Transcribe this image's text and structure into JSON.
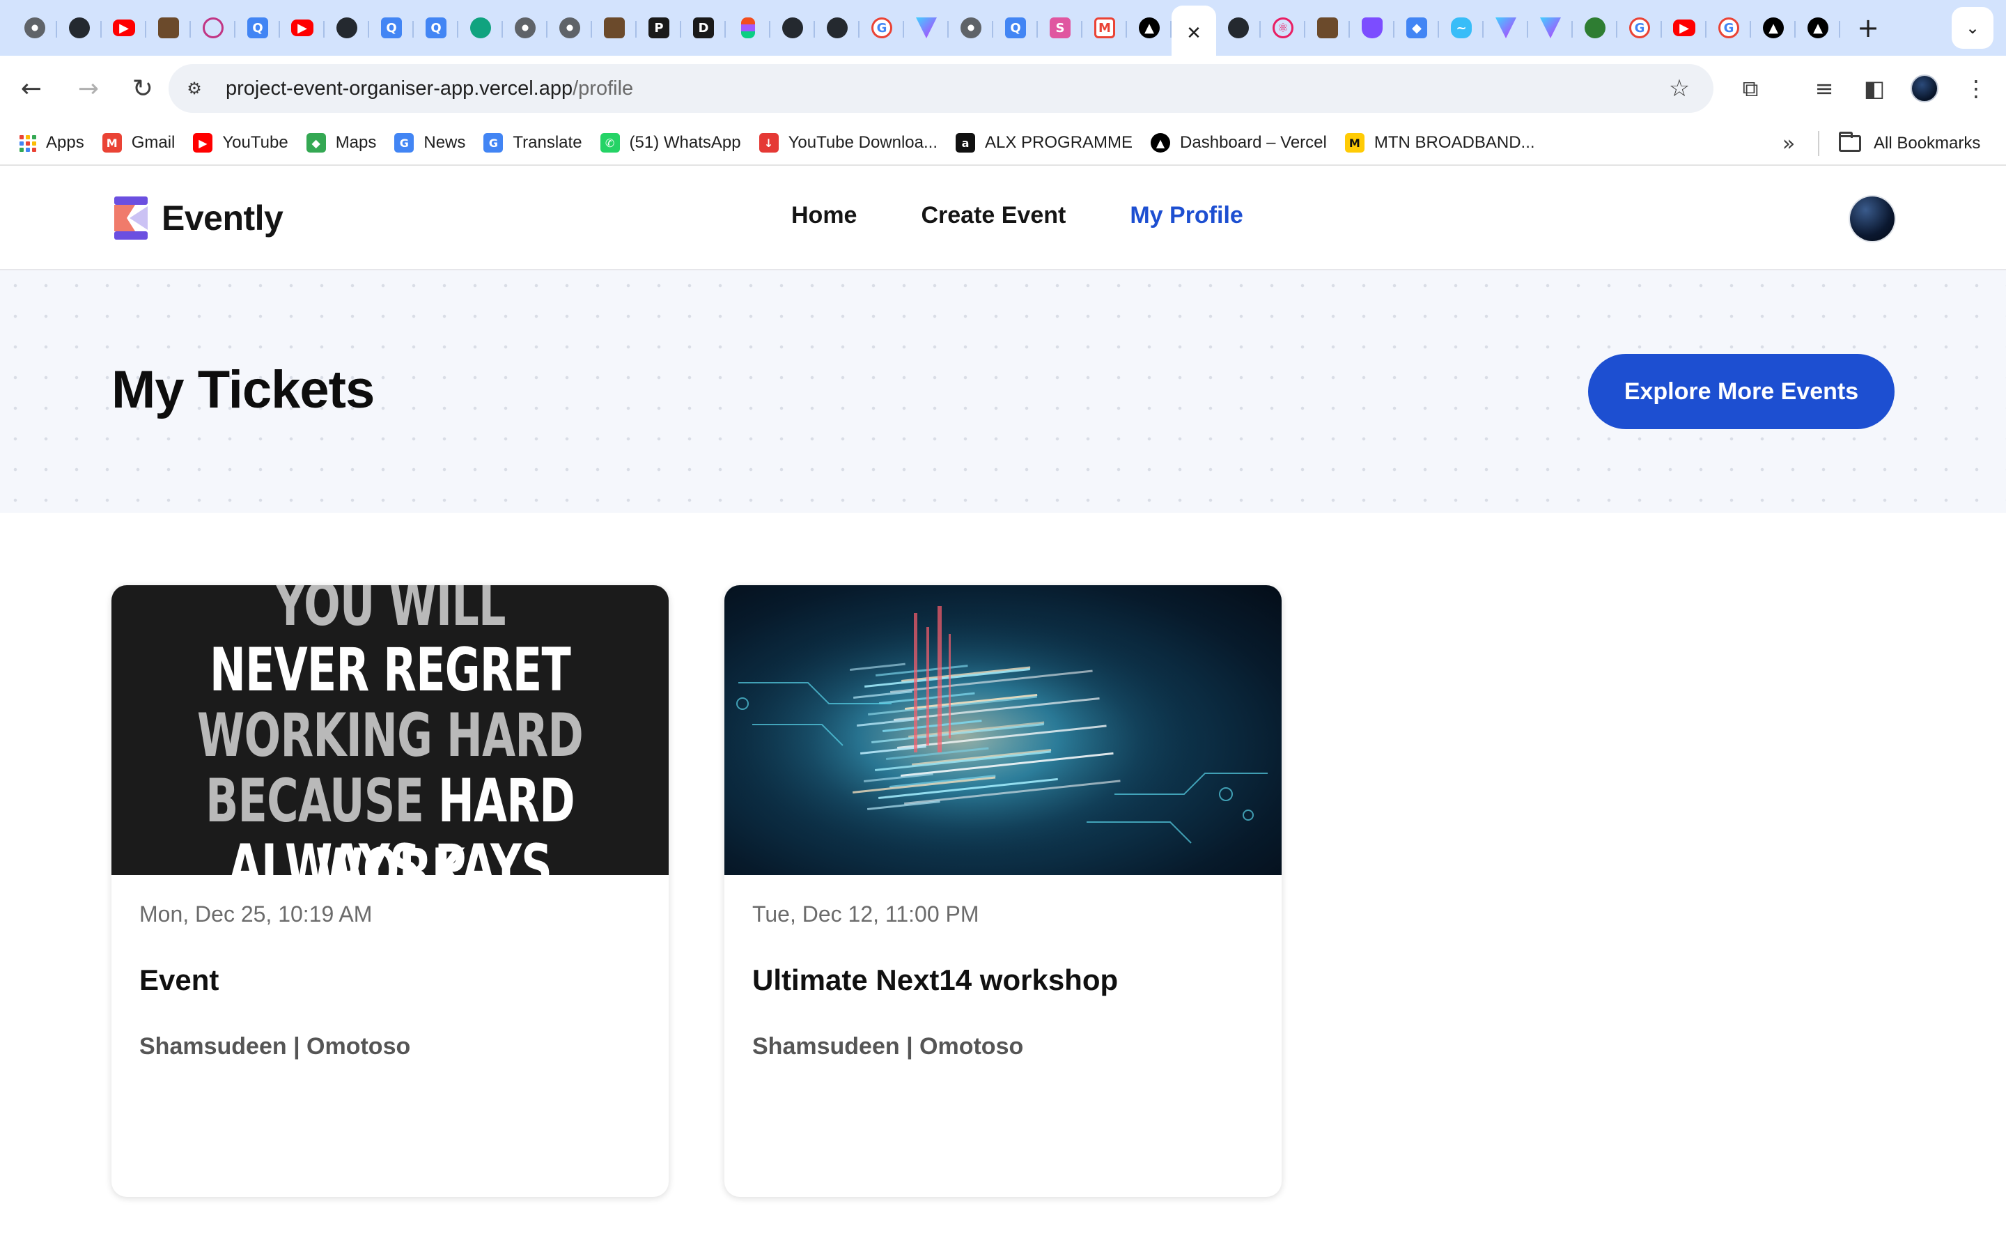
{
  "browser": {
    "tabs": [
      {
        "icon": "globe-icon"
      },
      {
        "icon": "github-icon"
      },
      {
        "icon": "youtube-icon"
      },
      {
        "icon": "book-icon"
      },
      {
        "icon": "instagram-icon"
      },
      {
        "icon": "q-icon"
      },
      {
        "icon": "youtube-icon"
      },
      {
        "icon": "github-icon"
      },
      {
        "icon": "q-icon"
      },
      {
        "icon": "q-icon"
      },
      {
        "icon": "chatgpt-icon"
      },
      {
        "icon": "globe-icon"
      },
      {
        "icon": "globe-icon"
      },
      {
        "icon": "book-icon"
      },
      {
        "icon": "p-icon"
      },
      {
        "icon": "d-icon"
      },
      {
        "icon": "figma-icon"
      },
      {
        "icon": "github-icon"
      },
      {
        "icon": "github-icon"
      },
      {
        "icon": "google-icon"
      },
      {
        "icon": "vite-icon"
      },
      {
        "icon": "globe-icon"
      },
      {
        "icon": "q-icon"
      },
      {
        "icon": "pink-app-icon"
      },
      {
        "icon": "gmail-icon"
      },
      {
        "icon": "vercel-icon"
      },
      {
        "icon": "close-icon",
        "active": true
      },
      {
        "icon": "github-icon"
      },
      {
        "icon": "react-icon"
      },
      {
        "icon": "bottle-icon"
      },
      {
        "icon": "shield-icon"
      },
      {
        "icon": "jira-icon"
      },
      {
        "icon": "tailwind-icon"
      },
      {
        "icon": "vite-icon"
      },
      {
        "icon": "vite-icon"
      },
      {
        "icon": "mongodb-icon"
      },
      {
        "icon": "google-icon"
      },
      {
        "icon": "youtube-icon"
      },
      {
        "icon": "google-icon"
      },
      {
        "icon": "vercel-icon"
      },
      {
        "icon": "vercel-icon"
      }
    ],
    "new_tab_label": "+",
    "url_host": "project-event-organiser-app.vercel.app",
    "url_path": "/profile",
    "bookmarks": [
      {
        "label": "Apps",
        "icon": "apps-grid-icon"
      },
      {
        "label": "Gmail",
        "icon": "gmail-icon",
        "color": "#ea4335"
      },
      {
        "label": "YouTube",
        "icon": "youtube-icon",
        "color": "#ff0000"
      },
      {
        "label": "Maps",
        "icon": "maps-icon",
        "color": "#34a853"
      },
      {
        "label": "News",
        "icon": "google-news-icon",
        "color": "#4285f4"
      },
      {
        "label": "Translate",
        "icon": "translate-icon",
        "color": "#4285f4"
      },
      {
        "label": "(51) WhatsApp",
        "icon": "whatsapp-icon",
        "color": "#25d366"
      },
      {
        "label": "YouTube Downloa...",
        "icon": "download-icon",
        "color": "#e53935"
      },
      {
        "label": "ALX PROGRAMME",
        "icon": "alx-icon",
        "color": "#111111"
      },
      {
        "label": "Dashboard – Vercel",
        "icon": "vercel-icon",
        "color": "#000000"
      },
      {
        "label": "MTN BROADBAND...",
        "icon": "mtn-icon",
        "color": "#ffcb05"
      }
    ],
    "all_bookmarks_label": "All Bookmarks"
  },
  "app": {
    "brand": "Evently",
    "nav": [
      {
        "label": "Home",
        "active": false
      },
      {
        "label": "Create Event",
        "active": false
      },
      {
        "label": "My Profile",
        "active": true
      }
    ],
    "accent_color": "#1d4fd1",
    "page_title": "My Tickets",
    "explore_button": "Explore More Events",
    "tickets": [
      {
        "date": "Mon, Dec 25, 10:19 AM",
        "title": "Event",
        "organizer": "Shamsudeen | Omotoso",
        "image": "motivational-poster",
        "poster_lines": [
          [
            {
              "t": "YOU WILL",
              "c": "g"
            }
          ],
          [
            {
              "t": "NEVER REGRET",
              "c": "w"
            }
          ],
          [
            {
              "t": "WORKING HARD",
              "c": "g"
            }
          ],
          [
            {
              "t": "BECAUSE ",
              "c": "g"
            },
            {
              "t": "HARD WORK",
              "c": "w"
            }
          ],
          [
            {
              "t": "ALWAYS PAYS OFF",
              "c": "w"
            }
          ]
        ]
      },
      {
        "date": "Tue, Dec 12, 11:00 PM",
        "title": "Ultimate Next14 workshop",
        "organizer": "Shamsudeen | Omotoso",
        "image": "code-visualization"
      }
    ]
  }
}
